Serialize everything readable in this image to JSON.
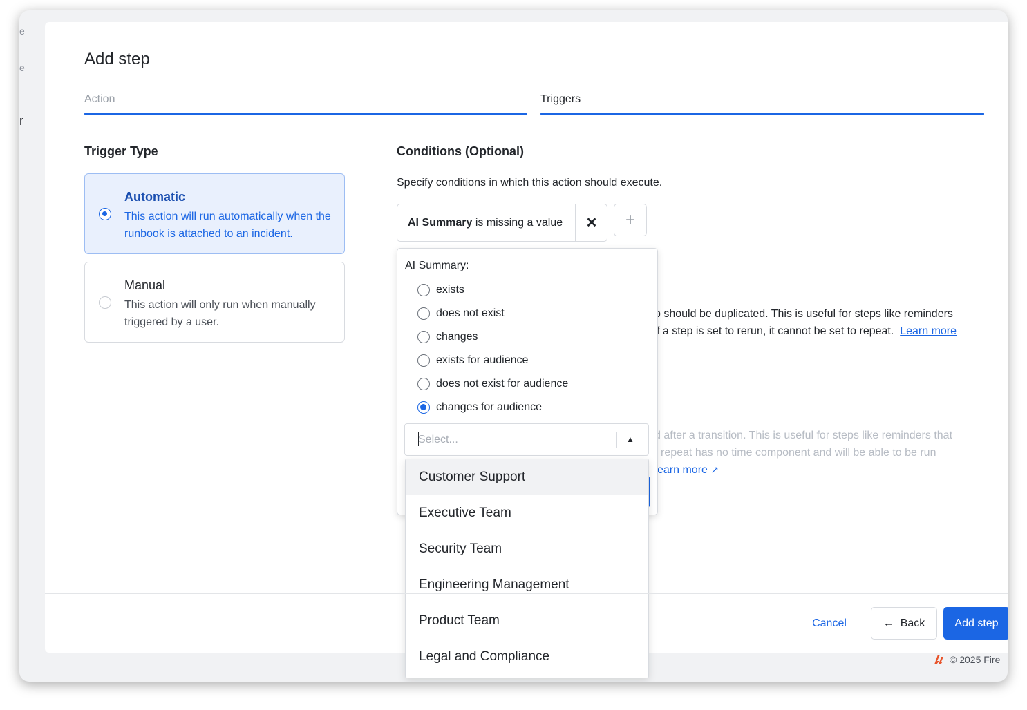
{
  "modal": {
    "title": "Add step",
    "tabs": [
      {
        "label": "Action"
      },
      {
        "label": "Triggers"
      }
    ]
  },
  "trigger_type": {
    "heading": "Trigger Type",
    "options": [
      {
        "title": "Automatic",
        "description": "This action will run automatically when the runbook is attached to an incident.",
        "selected": true
      },
      {
        "title": "Manual",
        "description": "This action will only run when manually triggered by a user.",
        "selected": false
      }
    ]
  },
  "conditions": {
    "heading": "Conditions (Optional)",
    "description": "Specify conditions in which this action should execute.",
    "pill": {
      "field": "AI Summary",
      "rest": "is missing a value",
      "remove_icon": "close-icon"
    },
    "add_icon": "plus-icon"
  },
  "background_text": {
    "line1": "p should be duplicated. This is useful for steps like reminders",
    "line2": "f a step is set to rerun, it cannot be set to repeat.",
    "learn_more_1": "Learn more",
    "line3": "d after a transition. This is useful for steps like reminders that",
    "line4": "repeat has no time component and will be able to be run",
    "learn_more_2": "earn more"
  },
  "popover": {
    "label": "AI Summary:",
    "options": [
      {
        "label": "exists",
        "selected": false
      },
      {
        "label": "does not exist",
        "selected": false
      },
      {
        "label": "changes",
        "selected": false
      },
      {
        "label": "exists for audience",
        "selected": false
      },
      {
        "label": "does not exist for audience",
        "selected": false
      },
      {
        "label": "changes for audience",
        "selected": true
      }
    ],
    "select_placeholder": "Select...",
    "chevron_icon": "chevron-up-icon"
  },
  "audience_menu": {
    "items": [
      "Customer Support",
      "Executive Team",
      "Security Team",
      "Engineering Management",
      "Product Team",
      "Legal and Compliance"
    ],
    "highlighted_index": 0
  },
  "footer": {
    "cancel": "Cancel",
    "back": "Back",
    "back_icon": "arrow-left-icon",
    "add": "Add step"
  },
  "page_footer": {
    "copyright": "© 2025 Fire"
  },
  "colors": {
    "accent": "#1b66e4",
    "selected_card_bg": "#e9f0fd"
  }
}
